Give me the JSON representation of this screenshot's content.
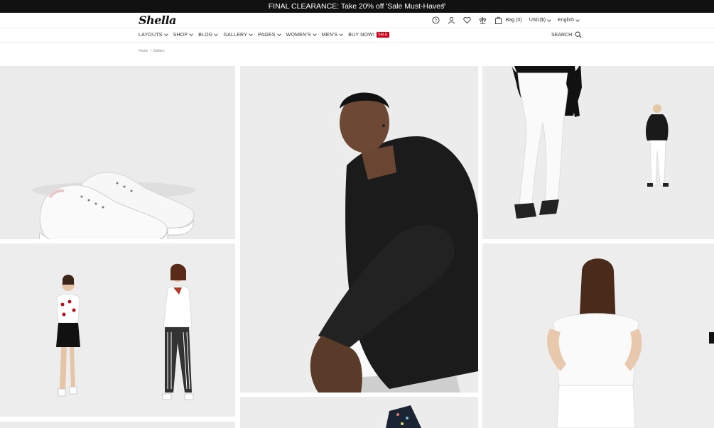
{
  "promo": {
    "text": "FINAL CLEARANCE: Take 20% off 'Sale Must-Haves'",
    "close": "×"
  },
  "header": {
    "logo": "Shella",
    "bag": "Bag (0)",
    "currency": "USD($)",
    "language": "English"
  },
  "nav": {
    "items": [
      "LAYOUTS",
      "SHOP",
      "BLOG",
      "GALLERY",
      "PAGES",
      "WOMEN'S",
      "MEN'S",
      "BUY NOW!"
    ],
    "sale_badge": "SALE",
    "search": "SEARCH"
  },
  "breadcrumb": {
    "home": "Home",
    "sep": "/",
    "current": "Gallery"
  },
  "colors": {
    "accent": "#d0021b",
    "promo_bg": "#111111",
    "tile_bg": "#ececec"
  }
}
